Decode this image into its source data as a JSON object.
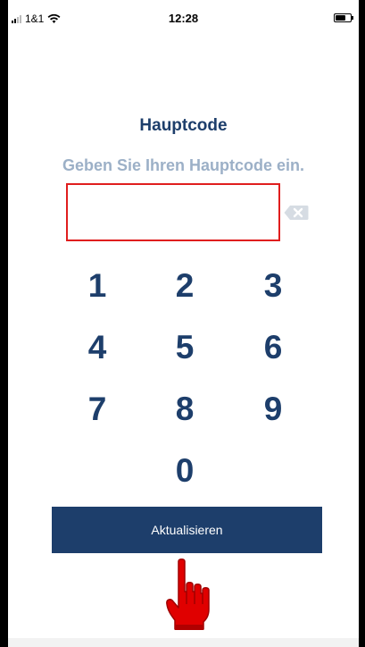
{
  "status_bar": {
    "carrier": "1&1",
    "time": "12:28",
    "signal_icon": "signal-bars-icon",
    "wifi_icon": "wifi-icon",
    "battery_icon": "battery-icon"
  },
  "screen": {
    "title": "Hauptcode",
    "subtitle": "Geben Sie Ihren Hauptcode ein.",
    "code_value": "",
    "backspace_icon": "backspace-icon"
  },
  "keypad": {
    "keys": [
      "1",
      "2",
      "3",
      "4",
      "5",
      "6",
      "7",
      "8",
      "9",
      "0"
    ]
  },
  "action": {
    "button_label": "Aktualisieren",
    "pointer_icon": "pointing-hand-icon"
  },
  "colors": {
    "primary": "#1d3e6b",
    "subtitle": "#9cb0c7",
    "highlight": "#e01e1e",
    "pointer": "#e00000"
  }
}
